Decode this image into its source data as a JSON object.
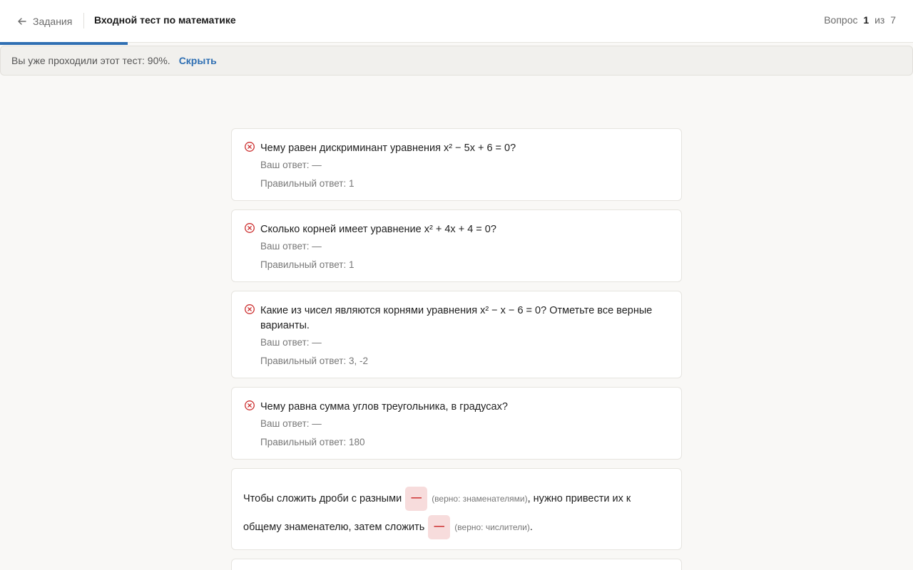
{
  "header": {
    "back_label": "Задания",
    "title": "Входной тест по математике",
    "counter_prefix": "Вопрос",
    "counter_current": "1",
    "counter_sep": "из",
    "counter_total": "7",
    "progress_fraction": 0.14
  },
  "notice": {
    "text": "Вы уже проходили этот тест: 90%.",
    "hide_label": "Скрыть"
  },
  "questions": [
    {
      "question": "Чему равен дискриминант уравнения x² − 5x + 6 = 0?",
      "your_answer": "Ваш ответ: —",
      "correct_answer": "Правильный ответ: 1"
    },
    {
      "question": "Сколько корней имеет уравнение x² + 4x + 4 = 0?",
      "your_answer": "Ваш ответ: —",
      "correct_answer": "Правильный ответ: 1"
    },
    {
      "question": "Какие из чисел являются корнями уравнения x² − x − 6 = 0? Отметьте все верные варианты.",
      "your_answer": "Ваш ответ: —",
      "correct_answer": "Правильный ответ: 3, -2"
    },
    {
      "question": "Чему равна сумма углов треугольника, в градусах?",
      "your_answer": "Ваш ответ: —",
      "correct_answer": "Правильный ответ: 180"
    }
  ],
  "fill_in": {
    "part1": "Чтобы сложить дроби с разными",
    "blank1": "—",
    "hint1": "(верно: знаменателями)",
    "part2": ", нужно привести их к общему знаменателю, затем сложить",
    "blank2": "—",
    "hint2": "(верно: числители)",
    "part3": "."
  },
  "colors": {
    "accent": "#2f6fb3",
    "error": "#cc2f2f",
    "blank_bg": "#f7dcdc"
  }
}
